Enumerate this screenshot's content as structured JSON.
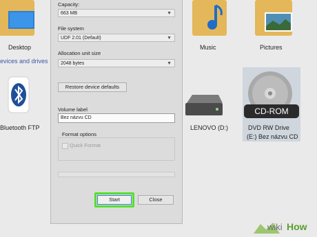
{
  "explorer": {
    "folders": [
      {
        "label": "Desktop"
      },
      {
        "label": "Music"
      },
      {
        "label": "Pictures"
      }
    ],
    "section_label": "evices and drives",
    "drives": [
      {
        "label": "Bluetooth FTP"
      },
      {
        "label": "LENOVO (D:)"
      },
      {
        "label_line1": "DVD RW Drive",
        "label_line2": "(E:) Bez názvu CD",
        "badge": "CD-ROM"
      }
    ]
  },
  "dialog": {
    "capacity_label": "Capacity:",
    "capacity_value": "663 MB",
    "filesystem_label": "File system",
    "filesystem_value": "UDF 2.01 (Default)",
    "allocation_label": "Allocation unit size",
    "allocation_value": "2048 bytes",
    "restore_button": "Restore device defaults",
    "volume_label": "Volume label",
    "volume_value": "Bez názvu CD",
    "format_options_label": "Format options",
    "quick_format_label": "Quick Format",
    "start_button": "Start",
    "close_button": "Close"
  },
  "watermark": {
    "part1": "wiki",
    "part2": "How"
  },
  "colors": {
    "highlight": "#55e02a",
    "folder": "#e9c46a",
    "wikihow_green": "#8fc05a"
  }
}
